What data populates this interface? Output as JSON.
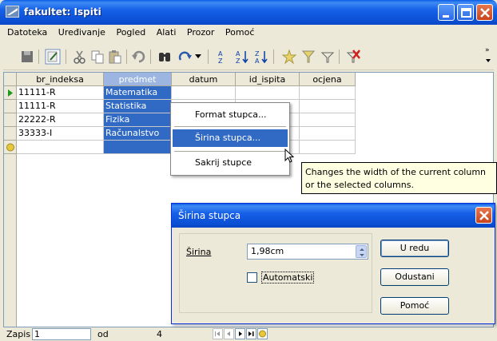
{
  "window": {
    "title": "fakultet: Ispiti"
  },
  "menu": [
    "Datoteka",
    "Uređivanje",
    "Pogled",
    "Alati",
    "Prozor",
    "Pomoć"
  ],
  "grid": {
    "columns": [
      "br_indeksa",
      "predmet",
      "datum",
      "id_ispita",
      "ocjena"
    ],
    "selected_column": "predmet",
    "rows": [
      [
        "11111-R",
        "Matematika",
        "",
        "",
        ""
      ],
      [
        "11111-R",
        "Statistika",
        "",
        "",
        ""
      ],
      [
        "22222-R",
        "Fizika",
        "",
        "",
        ""
      ],
      [
        "33333-I",
        "Računalstvo",
        "",
        "",
        ""
      ]
    ]
  },
  "context_menu": {
    "items": [
      "Format stupca...",
      "Širina stupca...",
      "Sakrij stupce"
    ],
    "highlighted": "Širina stupca..."
  },
  "tooltip": {
    "line1": "Changes the width of the current column",
    "line2": "or the selected columns."
  },
  "dialog": {
    "title": "Širina stupca",
    "width_label": "Širina",
    "width_value": "1,98cm",
    "auto_label": "Automatski",
    "auto_checked": false,
    "ok_label": "U redu",
    "cancel_label": "Odustani",
    "help_label": "Pomoć"
  },
  "status": {
    "record_label": "Zapis",
    "record_value": "1",
    "of_label": "od",
    "total": "4"
  },
  "colors": {
    "title_blue": "#0b4fd3",
    "selection": "#316ac5",
    "tooltip_bg": "#ffffe1",
    "close_red": "#c8431b"
  },
  "icons": [
    "save-icon",
    "edit-icon",
    "cut-icon",
    "copy-icon",
    "paste-icon",
    "undo-icon",
    "find-icon",
    "redo-icon",
    "sort-icon",
    "sort-ascending-icon",
    "sort-descending-icon",
    "autofilter-icon",
    "standard-filter-icon",
    "filter-icon",
    "remove-filter-icon"
  ]
}
